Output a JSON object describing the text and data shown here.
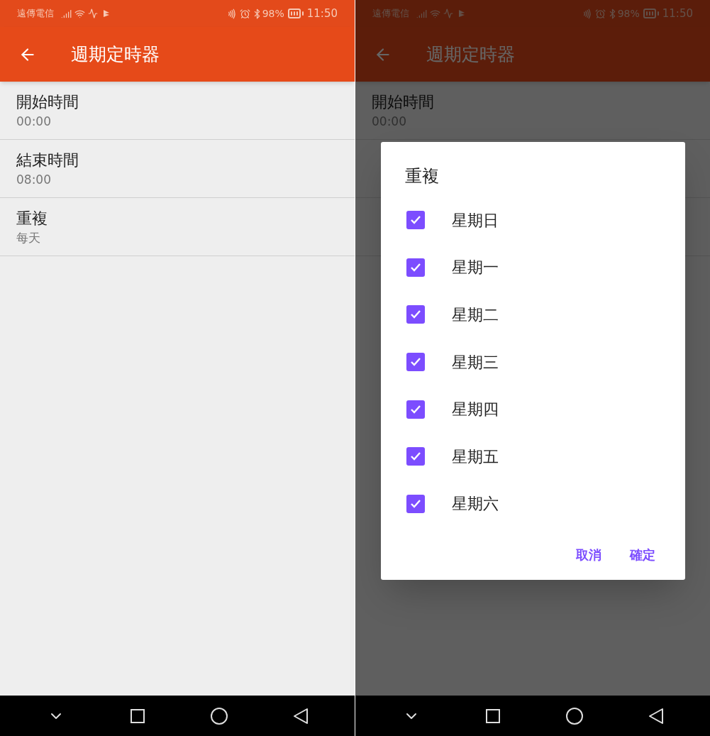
{
  "screens": [
    {
      "status_bar": {
        "carrier": "遠傳電信",
        "battery": "98%",
        "time": "11:50"
      },
      "app_bar": {
        "title": "週期定時器"
      },
      "dimmed": false,
      "settings": [
        {
          "title": "開始時間",
          "value": "00:00"
        },
        {
          "title": "結束時間",
          "value": "08:00"
        },
        {
          "title": "重複",
          "value": "每天"
        }
      ]
    },
    {
      "status_bar": {
        "carrier": "遠傳電信",
        "battery": "98%",
        "time": "11:50"
      },
      "app_bar": {
        "title": "週期定時器"
      },
      "dimmed": true,
      "settings": [
        {
          "title": "開始時間",
          "value": "00:00"
        }
      ],
      "dialog": {
        "title": "重複",
        "options": [
          {
            "label": "星期日",
            "checked": true
          },
          {
            "label": "星期一",
            "checked": true
          },
          {
            "label": "星期二",
            "checked": true
          },
          {
            "label": "星期三",
            "checked": true
          },
          {
            "label": "星期四",
            "checked": true
          },
          {
            "label": "星期五",
            "checked": true
          },
          {
            "label": "星期六",
            "checked": true
          }
        ],
        "buttons": [
          "取消",
          "確定"
        ]
      }
    }
  ]
}
